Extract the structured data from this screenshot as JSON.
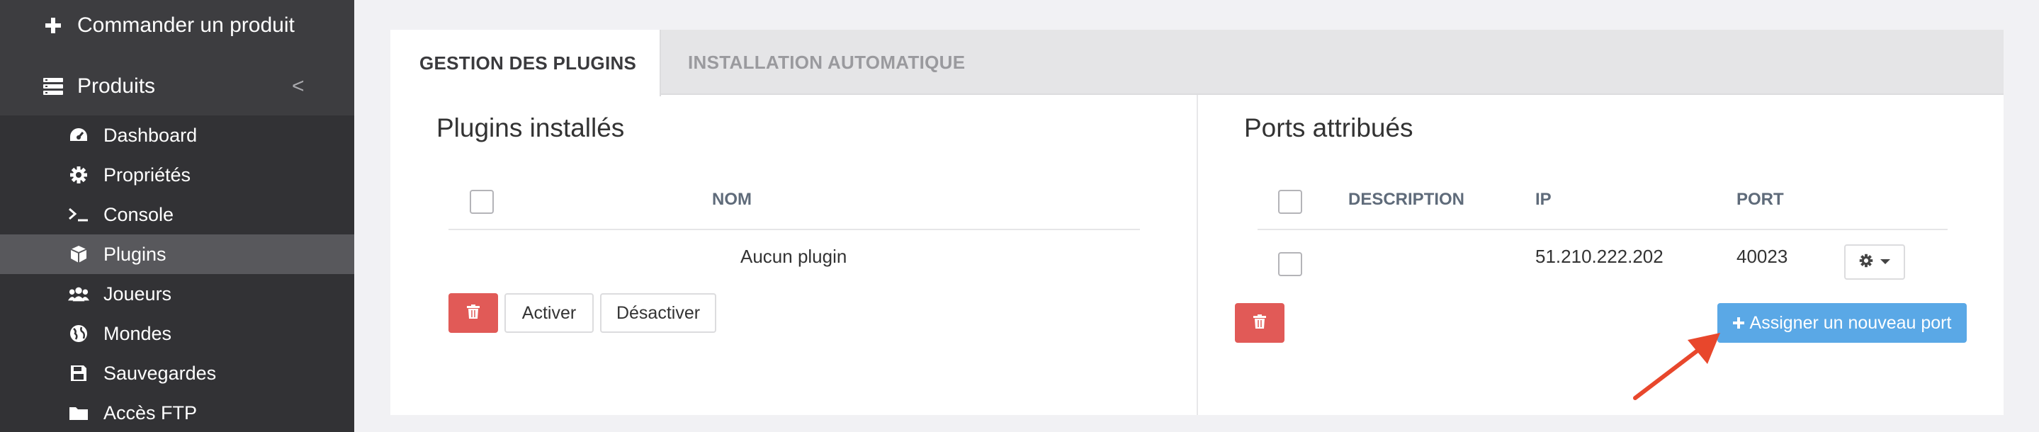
{
  "sidebar": {
    "order_product": "Commander un produit",
    "products": "Produits",
    "products_chevron": "<",
    "items": [
      {
        "label": "Dashboard",
        "icon": "dashboard-icon"
      },
      {
        "label": "Propriétés",
        "icon": "gear-icon"
      },
      {
        "label": "Console",
        "icon": "terminal-icon"
      },
      {
        "label": "Plugins",
        "icon": "cube-icon",
        "active": true
      },
      {
        "label": "Joueurs",
        "icon": "users-icon"
      },
      {
        "label": "Mondes",
        "icon": "globe-icon"
      },
      {
        "label": "Sauvegardes",
        "icon": "save-icon"
      },
      {
        "label": "Accès FTP",
        "icon": "folder-icon"
      }
    ]
  },
  "tabs": [
    {
      "label": "GESTION DES PLUGINS",
      "active": true
    },
    {
      "label": "INSTALLATION AUTOMATIQUE",
      "active": false
    }
  ],
  "plugins": {
    "title": "Plugins installés",
    "column_name": "NOM",
    "empty_text": "Aucun plugin",
    "activate_label": "Activer",
    "deactivate_label": "Désactiver"
  },
  "ports": {
    "title": "Ports attribués",
    "columns": {
      "description": "DESCRIPTION",
      "ip": "IP",
      "port": "PORT"
    },
    "rows": [
      {
        "description": "",
        "ip": "51.210.222.202",
        "port": "40023"
      }
    ],
    "assign_label": "Assigner un nouveau port"
  },
  "colors": {
    "sidebar_bg": "#3d3d40",
    "subnav_bg": "#323235",
    "active_item_bg": "#58585c",
    "danger": "#e15a57",
    "primary": "#5aa8e6",
    "arrow": "#e8472c"
  }
}
